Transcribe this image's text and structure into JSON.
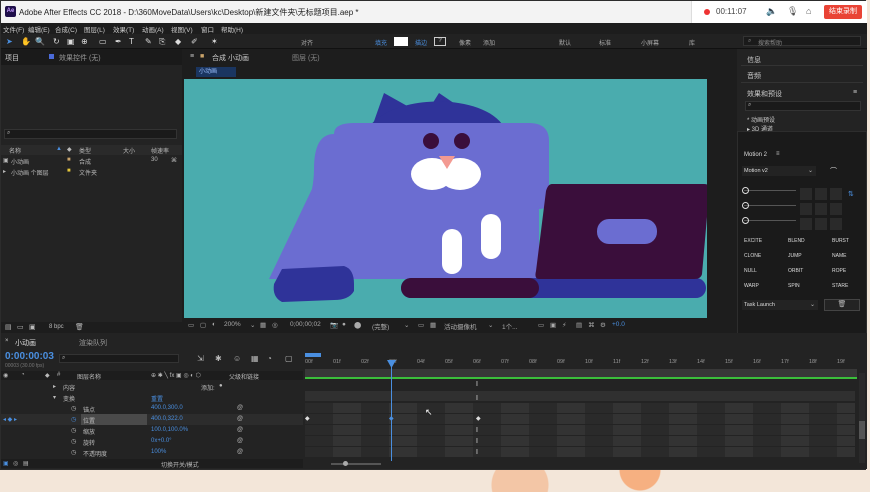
{
  "window": {
    "title": "Adobe After Effects CC 2018 - D:\\360MoveData\\Users\\kc\\Desktop\\新建文件夹\\无标题项目.aep *"
  },
  "recorder": {
    "time": "00:11:07",
    "stop_label": "结束录制"
  },
  "menu": [
    "文件(F)",
    "编辑(E)",
    "合成(C)",
    "图层(L)",
    "效果(T)",
    "动画(A)",
    "视图(V)",
    "窗口",
    "帮助(H)"
  ],
  "toolbar": {
    "snap_label": "对齐",
    "fill_label": "填充",
    "stroke_label": "描边",
    "px_label": "像素",
    "add_label": "添加",
    "workspaces": [
      "默认",
      "标准",
      "小屏幕",
      "库"
    ],
    "search_placeholder": "搜索帮助"
  },
  "project_panel": {
    "tab": "项目",
    "effects_tab": "效果控件 (无)",
    "search_placeholder": "",
    "columns": {
      "name": "名称",
      "type": "类型",
      "size": "大小",
      "fps": "帧速率"
    },
    "items": [
      {
        "name": "小动画",
        "type": "合成",
        "size": "",
        "fps": "30"
      },
      {
        "name": "小动画 个图层",
        "type": "文件夹",
        "size": "",
        "fps": ""
      }
    ],
    "bpc": "8 bpc"
  },
  "composition": {
    "tab": "合成 小动画",
    "layer_tab": "图层 (无)",
    "subtab": "小动画"
  },
  "viewer": {
    "zoom": "200%",
    "timecode": "0;00;00;02",
    "resolution": "(完整)",
    "camera": "活动摄像机",
    "views": "1个...",
    "exposure": "+0.0"
  },
  "right_panel": {
    "info": "信息",
    "audio": "音频",
    "effects": "效果和预设",
    "presets": [
      "* 动画预设",
      "▸ 3D 通道"
    ]
  },
  "motion": {
    "title": "Motion 2",
    "preset": "Motion v2",
    "buttons": [
      "EXCITE",
      "BLEND",
      "BURST",
      "CLONE",
      "JUMP",
      "NAME",
      "NULL",
      "ORBIT",
      "ROPE",
      "WARP",
      "SPIN",
      "STARE"
    ],
    "task": "Task Launch"
  },
  "timeline": {
    "comp_tab": "小动画",
    "render_tab": "渲染队列",
    "timecode": "0:00:00:03",
    "frame_info": "00003 (30.00 fps)",
    "layer_header": "图层名称",
    "parent_header": "父级和链接",
    "switches_label": "切换开关/模式",
    "add_label": "添加:",
    "rows": [
      {
        "name": "内容",
        "value": ""
      },
      {
        "name": "变换",
        "value": "重置"
      },
      {
        "name": "锚点",
        "value": "400.0,300.0"
      },
      {
        "name": "位置",
        "value": "400.0,322.0"
      },
      {
        "name": "缩放",
        "value": "100.0,100.0%"
      },
      {
        "name": "旋转",
        "value": "0x+0.0°"
      },
      {
        "name": "不透明度",
        "value": "100%"
      }
    ],
    "ruler": [
      "00f",
      "01f",
      "02f",
      "03f",
      "04f",
      "05f",
      "06f",
      "07f",
      "08f",
      "09f",
      "10f",
      "11f",
      "12f",
      "13f",
      "14f",
      "15f",
      "16f",
      "17f",
      "18f",
      "19f"
    ]
  },
  "colors": {
    "canvas": "#4aacae",
    "cat": "#6b6dd1",
    "cat_dark": "#2f3399",
    "laptop": "#3a0e3b",
    "accent": "#4a8fe0"
  }
}
